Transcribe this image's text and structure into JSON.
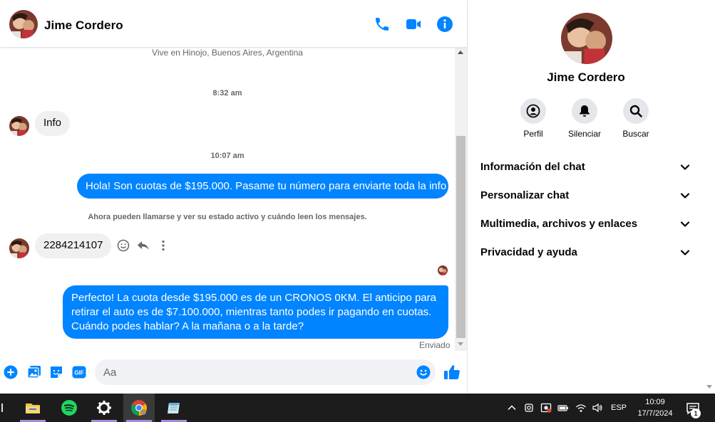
{
  "chat": {
    "contact_name": "Jime Cordero",
    "location": "Vive en Hinojo, Buenos Aires, Argentina",
    "time1": "8:32 am",
    "msg_info": "Info",
    "time2": "10:07 am",
    "msg_hola": "Hola! Son cuotas de $195.000. Pasame tu número para enviarte toda la info",
    "notice": "Ahora pueden llamarse y ver su estado activo y cuándo leen los mensajes.",
    "msg_number": "2284214107",
    "msg_perfecto": "Perfecto! La cuota desde $195.000 es de un CRONOS 0KM. El anticipo para retirar el auto es de $7.100.000, mientras tanto podes ir pagando en cuotas. Cuándo podes hablar? A la mañana o a la tarde?",
    "sent_status": "Enviado"
  },
  "composer": {
    "placeholder": "Aa",
    "gif_label": "GIF"
  },
  "details": {
    "name": "Jime Cordero",
    "actions": [
      {
        "label": "Perfil",
        "icon": "profile-icon"
      },
      {
        "label": "Silenciar",
        "icon": "bell-icon"
      },
      {
        "label": "Buscar",
        "icon": "search-icon"
      }
    ],
    "sections": [
      {
        "label": "Información del chat"
      },
      {
        "label": "Personalizar chat"
      },
      {
        "label": "Multimedia, archivos y enlaces"
      },
      {
        "label": "Privacidad y ayuda"
      }
    ]
  },
  "taskbar": {
    "lang": "ESP",
    "time": "10:09",
    "date": "17/7/2024",
    "notification_count": "1"
  },
  "colors": {
    "accent": "#0084ff",
    "incoming_bubble": "#f0f0f0",
    "taskbar": "#1c1c1c"
  }
}
